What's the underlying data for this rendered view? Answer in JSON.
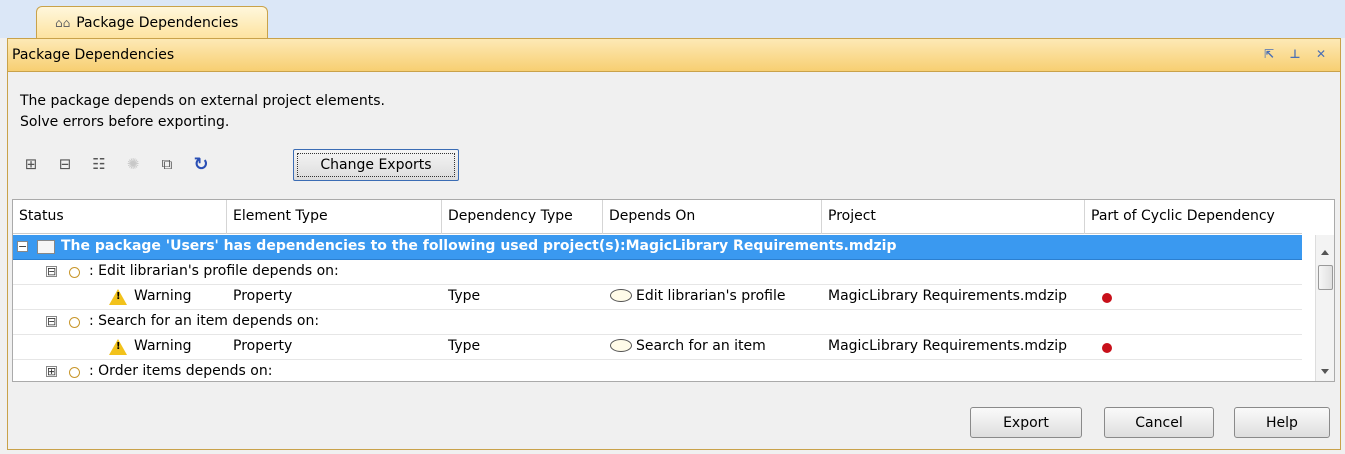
{
  "tab": {
    "label": "Package Dependencies"
  },
  "dialog": {
    "title": "Package Dependencies",
    "message_line1": "The package depends on external project elements.",
    "message_line2": "Solve errors before exporting."
  },
  "toolbar": {
    "icons": [
      "expand-all-icon",
      "collapse-all-icon",
      "tree-icon",
      "lightbulb-icon",
      "hierarchy-icon",
      "refresh-icon"
    ],
    "change_exports_label": "Change Exports"
  },
  "table": {
    "columns": [
      "Status",
      "Element Type",
      "Dependency Type",
      "Depends On",
      "Project",
      "Part of Cyclic Dependency"
    ],
    "group_row": "The package 'Users' has dependencies to the following used project(s):MagicLibrary Requirements.mdzip",
    "items": [
      {
        "label": ": Edit librarian's  profile depends on:",
        "expander": "⊟",
        "child": {
          "status": "Warning",
          "element_type": "Property",
          "dependency_type": "Type",
          "depends_on": "Edit librarian's  profile",
          "project": "MagicLibrary Requirements.mdzip"
        }
      },
      {
        "label": ": Search for an item depends on:",
        "expander": "⊟",
        "child": {
          "status": "Warning",
          "element_type": "Property",
          "dependency_type": "Type",
          "depends_on": "Search for an item",
          "project": "MagicLibrary Requirements.mdzip"
        }
      },
      {
        "label": ": Order items depends on:",
        "expander": "⊞"
      }
    ]
  },
  "buttons": {
    "export": "Export",
    "cancel": "Cancel",
    "help": "Help"
  },
  "colors": {
    "selection": "#3a99f0",
    "accent": "#f7cf72",
    "cyclic_dot": "#c8101a"
  }
}
